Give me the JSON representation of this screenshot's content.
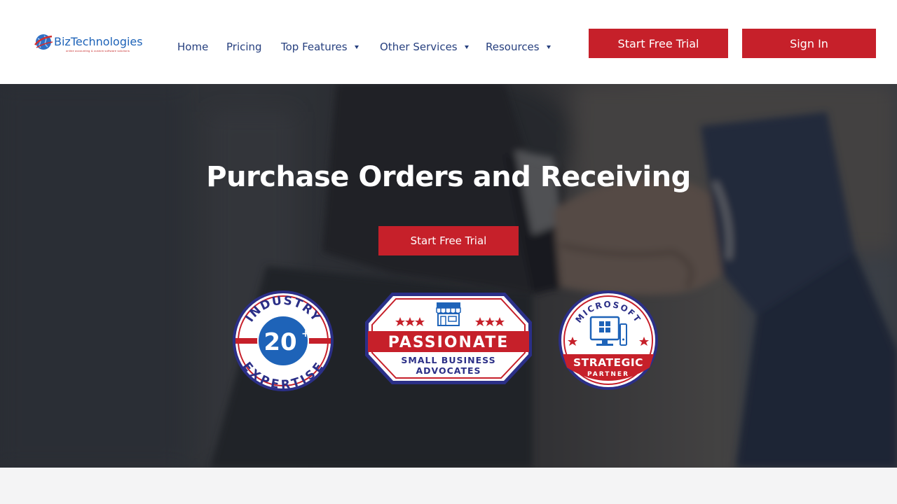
{
  "brand": {
    "name_prefix": "Biz",
    "name_suffix": "Technologies",
    "tagline": "online accounting & custom software solutions"
  },
  "nav": {
    "items": [
      {
        "label": "Home",
        "has_dropdown": false
      },
      {
        "label": "Pricing",
        "has_dropdown": false
      },
      {
        "label": "Top Features",
        "has_dropdown": true
      },
      {
        "label": "Other Services",
        "has_dropdown": true
      },
      {
        "label": "Resources",
        "has_dropdown": true
      }
    ]
  },
  "header_buttons": {
    "trial_label": "Start Free Trial",
    "signin_label": "Sign In"
  },
  "hero": {
    "title": "Purchase Orders and Receiving",
    "cta_label": "Start Free Trial"
  },
  "badges": {
    "industry": {
      "top_text": "INDUSTRY",
      "number": "20",
      "plus": "+",
      "bottom_text": "EXPERTISE"
    },
    "passionate": {
      "title": "PASSIONATE",
      "line1": "SMALL BUSINESS",
      "line2": "ADVOCATES"
    },
    "microsoft": {
      "top_text": "MICROSOFT",
      "title": "STRATEGIC",
      "subtitle": "PARTNER"
    }
  },
  "colors": {
    "brand_red": "#c6202a",
    "nav_blue": "#27407f",
    "badge_navy": "#2b2f87",
    "badge_blue": "#1e63b8"
  }
}
